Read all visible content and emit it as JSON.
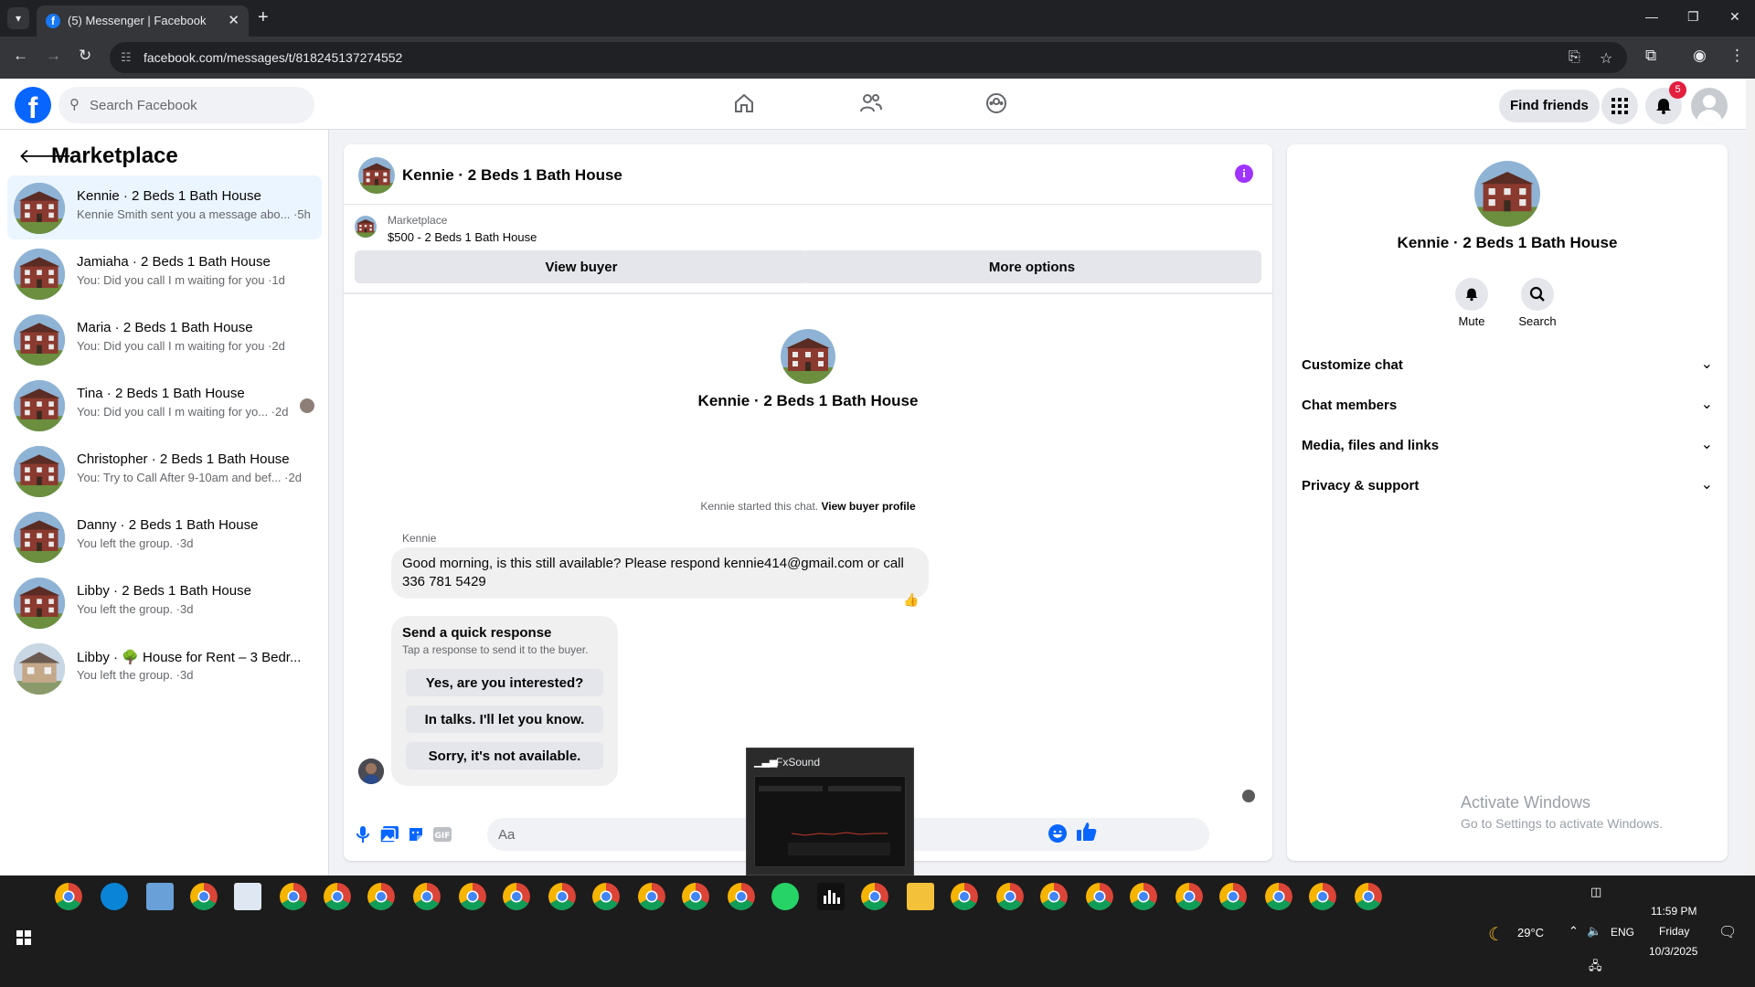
{
  "browser": {
    "tab_title": "(5) Messenger | Facebook",
    "url": "facebook.com/messages/t/818245137274552"
  },
  "header": {
    "search_placeholder": "Search Facebook",
    "find_friends": "Find friends",
    "notification_count": "5"
  },
  "sidebar": {
    "title": "Marketplace",
    "conversations": [
      {
        "name": "Kennie · 2 Beds 1 Bath House",
        "preview": "Kennie Smith sent you a message abo... ·5h"
      },
      {
        "name": "Jamiaha · 2 Beds 1 Bath House",
        "preview": "You: Did you call I m waiting for you ·1d"
      },
      {
        "name": "Maria · 2 Beds 1 Bath House",
        "preview": "You: Did you call I m waiting for you ·2d"
      },
      {
        "name": "Tina · 2 Beds 1 Bath House",
        "preview": "You: Did you call I m waiting for yo... ·2d"
      },
      {
        "name": "Christopher · 2 Beds 1 Bath House",
        "preview": "You: Try to Call After 9-10am and bef... ·2d"
      },
      {
        "name": "Danny · 2 Beds 1 Bath House",
        "preview": "You left the group. ·3d"
      },
      {
        "name": "Libby · 2 Beds 1 Bath House",
        "preview": "You left the group. ·3d"
      },
      {
        "name": "Libby · 🌳 House for Rent – 3 Bedr...",
        "preview": "You left the group. ·3d"
      }
    ]
  },
  "chat": {
    "title": "Kennie · 2 Beds 1 Bath House",
    "marketplace_label": "Marketplace",
    "listing": "$500 - 2 Beds 1 Bath House",
    "view_buyer": "View buyer",
    "more_options": "More options",
    "center_name": "Kennie · 2 Beds 1 Bath House",
    "started_text": "Kennie started this chat.",
    "view_buyer_profile": "View buyer profile",
    "sender": "Kennie",
    "message": "Good morning, is this still available? Please respond kennie414@gmail.com or call 336 781 5429",
    "quick_title": "Send a quick response",
    "quick_sub": "Tap a response to send it to the buyer.",
    "quick_responses": [
      "Yes, are you interested?",
      "In talks. I'll let you know.",
      "Sorry, it's not available."
    ],
    "composer_placeholder": "Aa"
  },
  "details": {
    "name": "Kennie · 2 Beds 1 Bath House",
    "mute": "Mute",
    "search": "Search",
    "sections": [
      "Customize chat",
      "Chat members",
      "Media, files and links",
      "Privacy & support"
    ]
  },
  "watermark": {
    "line1": "Activate Windows",
    "line2": "Go to Settings to activate Windows."
  },
  "popup": {
    "title": "FxSound"
  },
  "taskbar": {
    "temperature": "29°C",
    "language": "ENG",
    "time": "11:59 PM",
    "day": "Friday",
    "date": "10/3/2025"
  }
}
